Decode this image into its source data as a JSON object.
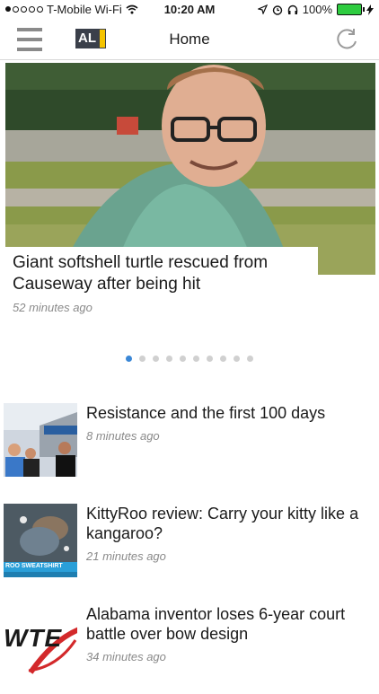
{
  "status": {
    "carrier": "T-Mobile Wi-Fi",
    "time": "10:20 AM",
    "battery": "100%",
    "signal_dots_filled": 1,
    "signal_dots_total": 5
  },
  "nav": {
    "logo_text": "AL",
    "title": "Home"
  },
  "hero": {
    "headline": "Giant softshell turtle rescued from Causeway after being hit",
    "time_ago": "52 minutes ago"
  },
  "pager": {
    "count": 10,
    "active_index": 0
  },
  "stories": [
    {
      "headline": "Resistance and the first 100 days",
      "time_ago": "8 minutes ago",
      "thumb_icon": "protest-photo"
    },
    {
      "headline": "KittyRoo review: Carry your kitty like a kangaroo?",
      "time_ago": "21 minutes ago",
      "thumb_icon": "cat-sweatshirt-photo",
      "thumb_caption": "ROO SWEATSHIRT"
    },
    {
      "headline": "Alabama inventor loses 6-year court battle over bow design",
      "time_ago": "34 minutes ago",
      "thumb_icon": "wte-logo",
      "thumb_logo_text": "WTE"
    }
  ],
  "colors": {
    "accent": "#3b87d6",
    "battery": "#2ecc40",
    "logo_yellow": "#f5c400"
  }
}
